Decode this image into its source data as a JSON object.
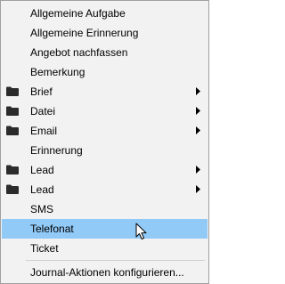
{
  "menu": {
    "items": [
      {
        "label": "Allgemeine Aufgabe"
      },
      {
        "label": "Allgemeine Erinnerung"
      },
      {
        "label": "Angebot nachfassen"
      },
      {
        "label": "Bemerkung"
      },
      {
        "label": "Brief",
        "icon": "folder-icon",
        "submenu": true
      },
      {
        "label": "Datei",
        "icon": "folder-icon",
        "submenu": true
      },
      {
        "label": "Email",
        "icon": "folder-icon",
        "submenu": true
      },
      {
        "label": "Erinnerung"
      },
      {
        "label": "Lead",
        "icon": "folder-icon",
        "submenu": true
      },
      {
        "label": "Lead",
        "icon": "folder-icon",
        "submenu": true
      },
      {
        "label": "SMS"
      },
      {
        "label": "Telefonat",
        "highlighted": true
      },
      {
        "label": "Ticket"
      }
    ],
    "configure_label": "Journal-Aktionen konfigurieren...",
    "highlight_color": "#91c9f7",
    "background_color": "#f2f2f2"
  }
}
